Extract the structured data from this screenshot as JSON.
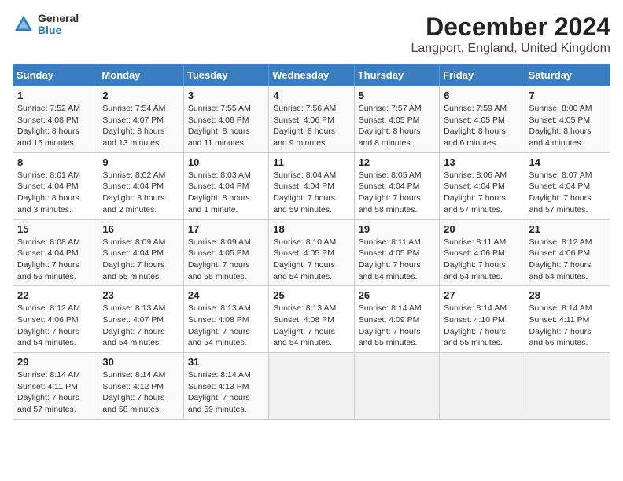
{
  "header": {
    "logo_line1": "General",
    "logo_line2": "Blue",
    "title": "December 2024",
    "subtitle": "Langport, England, United Kingdom"
  },
  "days_of_week": [
    "Sunday",
    "Monday",
    "Tuesday",
    "Wednesday",
    "Thursday",
    "Friday",
    "Saturday"
  ],
  "weeks": [
    [
      {
        "day": "1",
        "text": "Sunrise: 7:52 AM\nSunset: 4:08 PM\nDaylight: 8 hours and 15 minutes."
      },
      {
        "day": "2",
        "text": "Sunrise: 7:54 AM\nSunset: 4:07 PM\nDaylight: 8 hours and 13 minutes."
      },
      {
        "day": "3",
        "text": "Sunrise: 7:55 AM\nSunset: 4:06 PM\nDaylight: 8 hours and 11 minutes."
      },
      {
        "day": "4",
        "text": "Sunrise: 7:56 AM\nSunset: 4:06 PM\nDaylight: 8 hours and 9 minutes."
      },
      {
        "day": "5",
        "text": "Sunrise: 7:57 AM\nSunset: 4:05 PM\nDaylight: 8 hours and 8 minutes."
      },
      {
        "day": "6",
        "text": "Sunrise: 7:59 AM\nSunset: 4:05 PM\nDaylight: 8 hours and 6 minutes."
      },
      {
        "day": "7",
        "text": "Sunrise: 8:00 AM\nSunset: 4:05 PM\nDaylight: 8 hours and 4 minutes."
      }
    ],
    [
      {
        "day": "8",
        "text": "Sunrise: 8:01 AM\nSunset: 4:04 PM\nDaylight: 8 hours and 3 minutes."
      },
      {
        "day": "9",
        "text": "Sunrise: 8:02 AM\nSunset: 4:04 PM\nDaylight: 8 hours and 2 minutes."
      },
      {
        "day": "10",
        "text": "Sunrise: 8:03 AM\nSunset: 4:04 PM\nDaylight: 8 hours and 1 minute."
      },
      {
        "day": "11",
        "text": "Sunrise: 8:04 AM\nSunset: 4:04 PM\nDaylight: 7 hours and 59 minutes."
      },
      {
        "day": "12",
        "text": "Sunrise: 8:05 AM\nSunset: 4:04 PM\nDaylight: 7 hours and 58 minutes."
      },
      {
        "day": "13",
        "text": "Sunrise: 8:06 AM\nSunset: 4:04 PM\nDaylight: 7 hours and 57 minutes."
      },
      {
        "day": "14",
        "text": "Sunrise: 8:07 AM\nSunset: 4:04 PM\nDaylight: 7 hours and 57 minutes."
      }
    ],
    [
      {
        "day": "15",
        "text": "Sunrise: 8:08 AM\nSunset: 4:04 PM\nDaylight: 7 hours and 56 minutes."
      },
      {
        "day": "16",
        "text": "Sunrise: 8:09 AM\nSunset: 4:04 PM\nDaylight: 7 hours and 55 minutes."
      },
      {
        "day": "17",
        "text": "Sunrise: 8:09 AM\nSunset: 4:05 PM\nDaylight: 7 hours and 55 minutes."
      },
      {
        "day": "18",
        "text": "Sunrise: 8:10 AM\nSunset: 4:05 PM\nDaylight: 7 hours and 54 minutes."
      },
      {
        "day": "19",
        "text": "Sunrise: 8:11 AM\nSunset: 4:05 PM\nDaylight: 7 hours and 54 minutes."
      },
      {
        "day": "20",
        "text": "Sunrise: 8:11 AM\nSunset: 4:06 PM\nDaylight: 7 hours and 54 minutes."
      },
      {
        "day": "21",
        "text": "Sunrise: 8:12 AM\nSunset: 4:06 PM\nDaylight: 7 hours and 54 minutes."
      }
    ],
    [
      {
        "day": "22",
        "text": "Sunrise: 8:12 AM\nSunset: 4:06 PM\nDaylight: 7 hours and 54 minutes."
      },
      {
        "day": "23",
        "text": "Sunrise: 8:13 AM\nSunset: 4:07 PM\nDaylight: 7 hours and 54 minutes."
      },
      {
        "day": "24",
        "text": "Sunrise: 8:13 AM\nSunset: 4:08 PM\nDaylight: 7 hours and 54 minutes."
      },
      {
        "day": "25",
        "text": "Sunrise: 8:13 AM\nSunset: 4:08 PM\nDaylight: 7 hours and 54 minutes."
      },
      {
        "day": "26",
        "text": "Sunrise: 8:14 AM\nSunset: 4:09 PM\nDaylight: 7 hours and 55 minutes."
      },
      {
        "day": "27",
        "text": "Sunrise: 8:14 AM\nSunset: 4:10 PM\nDaylight: 7 hours and 55 minutes."
      },
      {
        "day": "28",
        "text": "Sunrise: 8:14 AM\nSunset: 4:11 PM\nDaylight: 7 hours and 56 minutes."
      }
    ],
    [
      {
        "day": "29",
        "text": "Sunrise: 8:14 AM\nSunset: 4:11 PM\nDaylight: 7 hours and 57 minutes."
      },
      {
        "day": "30",
        "text": "Sunrise: 8:14 AM\nSunset: 4:12 PM\nDaylight: 7 hours and 58 minutes."
      },
      {
        "day": "31",
        "text": "Sunrise: 8:14 AM\nSunset: 4:13 PM\nDaylight: 7 hours and 59 minutes."
      },
      null,
      null,
      null,
      null
    ]
  ]
}
